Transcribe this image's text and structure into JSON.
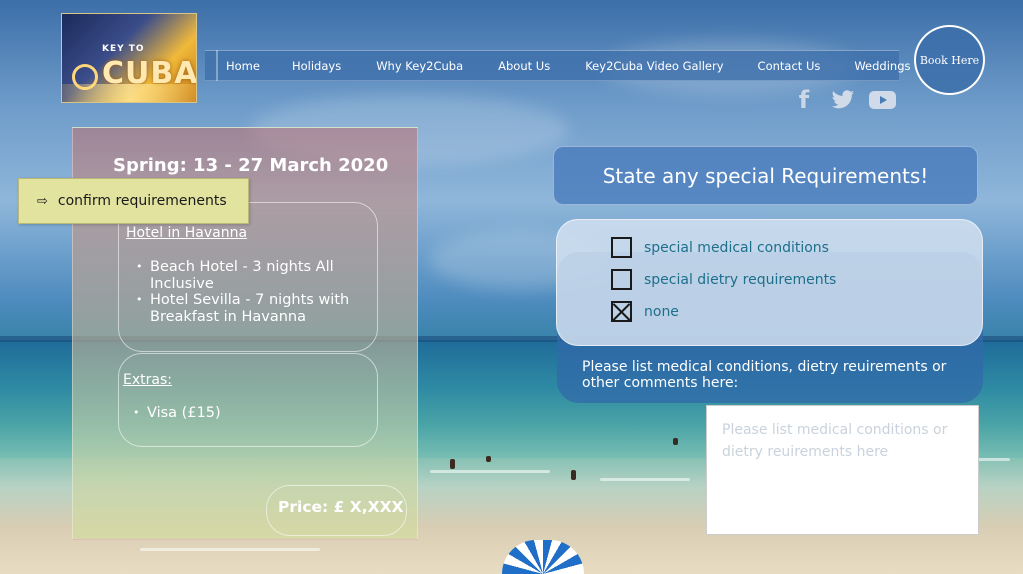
{
  "header": {
    "logo": {
      "small_text": "KEY TO",
      "main_text": "CUBA"
    },
    "nav": [
      {
        "label": "Home"
      },
      {
        "label": "Holidays"
      },
      {
        "label": "Why Key2Cuba"
      },
      {
        "label": "About Us"
      },
      {
        "label": "Key2Cuba Video Gallery"
      },
      {
        "label": "Contact Us"
      },
      {
        "label": "Weddings"
      }
    ],
    "book_button": "Book Here",
    "social": [
      {
        "icon": "facebook-icon",
        "glyph": "f"
      },
      {
        "icon": "twitter-icon"
      },
      {
        "icon": "youtube-icon"
      }
    ]
  },
  "trip": {
    "title": "Spring: 13 - 27 March 2020",
    "hotel_heading": "Hotel in Havanna",
    "hotels": [
      "Beach Hotel - 3 nights All Inclusive",
      "Hotel Sevilla - 7 nights with Breakfast in Havanna"
    ],
    "extras_heading": "Extras:",
    "extras": [
      "Visa (£15)"
    ],
    "price": "Price: £ X,XXX"
  },
  "tooltip": {
    "arrow": "⇨",
    "text": "confirm requiremenents"
  },
  "requirements": {
    "title": "State any special Requirements!",
    "options": [
      {
        "label": "special medical conditions",
        "checked": false
      },
      {
        "label": "special dietry requirements",
        "checked": false
      },
      {
        "label": "none",
        "checked": true
      }
    ],
    "instructions": "Please list medical conditions, dietry reuirements or other comments here:",
    "comments_placeholder": "Please list medical conditions or dietry reuirements here",
    "comments_value": ""
  }
}
